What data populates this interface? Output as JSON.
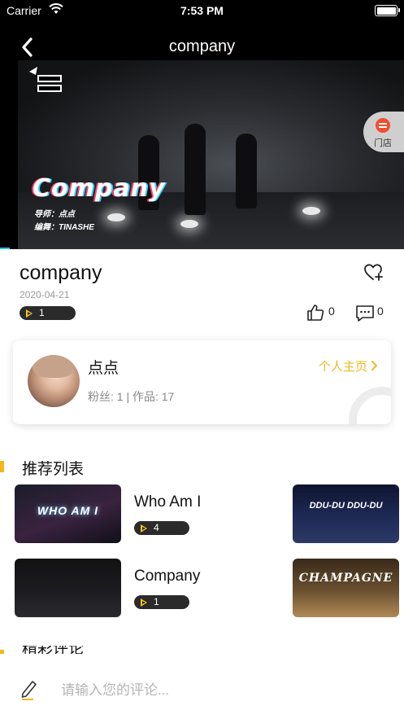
{
  "status_bar": {
    "carrier": "Carrier",
    "time": "7:53 PM"
  },
  "nav": {
    "title": "company"
  },
  "video": {
    "overlay_title": "Company",
    "credit_teacher": "导师：点点",
    "credit_choreo": "编舞：TINASHE"
  },
  "store_badge": {
    "label": "门店",
    "icon": "store-icon"
  },
  "work": {
    "title": "company",
    "date": "2020-04-21",
    "plays": "1",
    "likes": "0",
    "comments": "0"
  },
  "author": {
    "name": "点点",
    "meta": "粉丝: 1 | 作品: 17",
    "profile_link": "个人主页"
  },
  "recommend": {
    "section_title": "推荐列表",
    "items": [
      {
        "title": "Who Am I",
        "plays": "4",
        "thumb_caption": "WHO AM I",
        "side_caption": "DDU-DU DDU-DU"
      },
      {
        "title": "Company",
        "plays": "1",
        "thumb_caption": "",
        "side_caption": "CHAMPAGNE"
      }
    ]
  },
  "comments": {
    "section_title": "精彩评论"
  },
  "comment_input": {
    "placeholder": "请输入您的评论..."
  },
  "colors": {
    "accent": "#f2b81c",
    "dark_pill": "#2b2b2b",
    "header_bg": "#000000"
  }
}
